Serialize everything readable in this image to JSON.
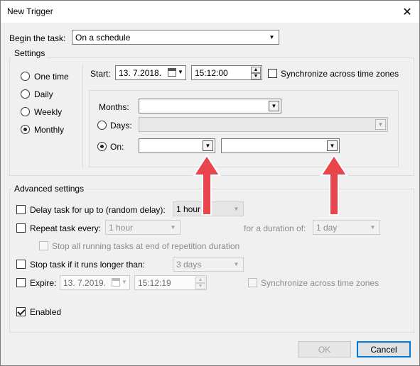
{
  "window": {
    "title": "New Trigger",
    "close_glyph": "✕"
  },
  "begin": {
    "label": "Begin the task:",
    "value": "On a schedule"
  },
  "settings": {
    "legend": "Settings",
    "radios": [
      {
        "label": "One time",
        "checked": false
      },
      {
        "label": "Daily",
        "checked": false
      },
      {
        "label": "Weekly",
        "checked": false
      },
      {
        "label": "Monthly",
        "checked": true
      }
    ],
    "start_label": "Start:",
    "start_date": "13.  7.2018.",
    "start_time": "15:12:00",
    "sync_label": "Synchronize across time zones",
    "months_label": "Months:",
    "months_value": "",
    "days_label": "Days:",
    "days_value": "",
    "on_label": "On:",
    "on_week_value": "",
    "on_day_value": ""
  },
  "advanced": {
    "legend": "Advanced settings",
    "delay_label": "Delay task for up to (random delay):",
    "delay_value": "1 hour",
    "repeat_label": "Repeat task every:",
    "repeat_value": "1 hour",
    "duration_label": "for a duration of:",
    "duration_value": "1 day",
    "stop_running_label": "Stop all running tasks at end of repetition duration",
    "stop_longer_label": "Stop task if it runs longer than:",
    "stop_longer_value": "3 days",
    "expire_label": "Expire:",
    "expire_date": "13.  7.2019.",
    "expire_time": "15:12:19",
    "expire_sync_label": "Synchronize across time zones",
    "enabled_label": "Enabled"
  },
  "buttons": {
    "ok": "OK",
    "cancel": "Cancel"
  },
  "glyphs": {
    "dropdown": "▼",
    "spin_up": "▲",
    "spin_down": "▼"
  },
  "colors": {
    "annotation_arrow": "#e8454d",
    "focus_blue": "#0078d7"
  }
}
